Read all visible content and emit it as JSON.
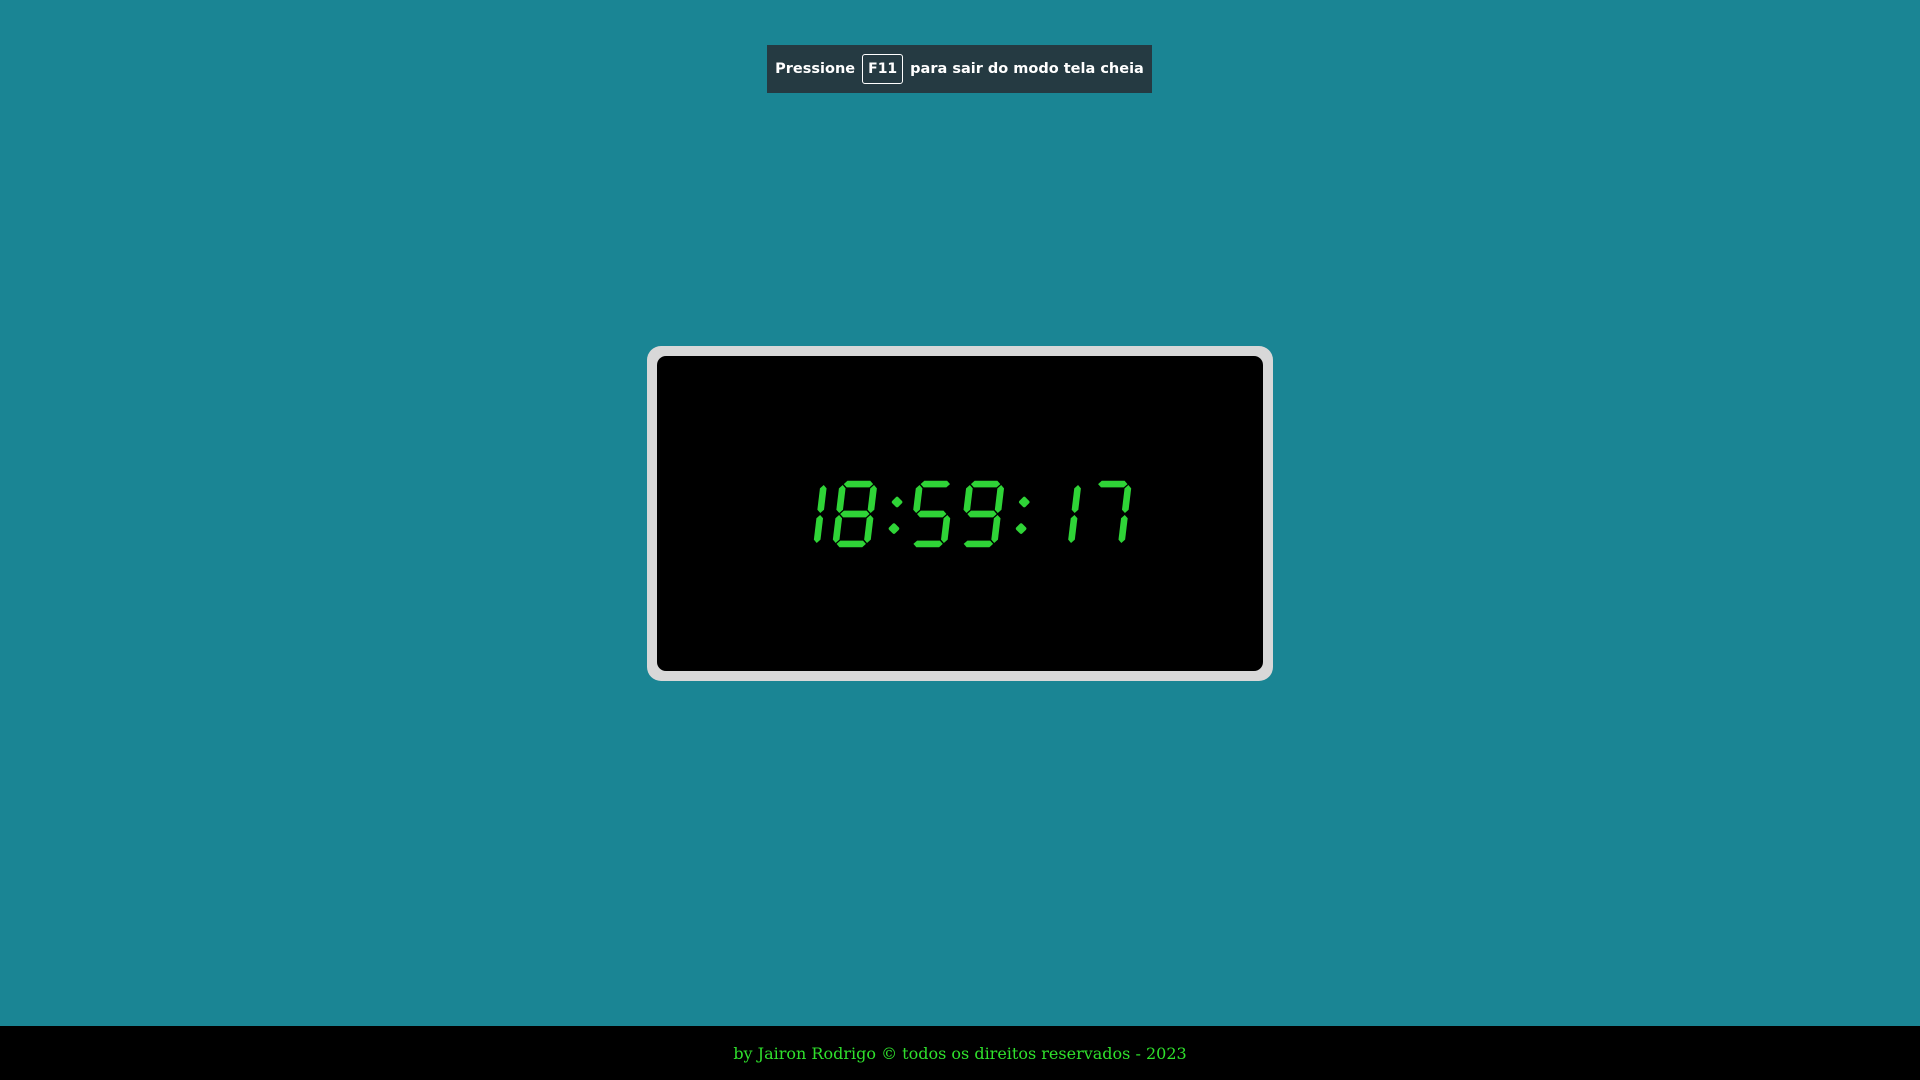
{
  "notice": {
    "prefix": "Pressione",
    "key": "F11",
    "suffix": "para sair do modo tela cheia"
  },
  "clock": {
    "time": "18:59:17",
    "digit_color": "#2fd437"
  },
  "footer": {
    "text": "by Jairon Rodrigo © todos os direitos reservados - 2023"
  },
  "colors": {
    "background": "#1a8594",
    "notice_bg": "#253a42",
    "frame": "#d8d8d8"
  }
}
